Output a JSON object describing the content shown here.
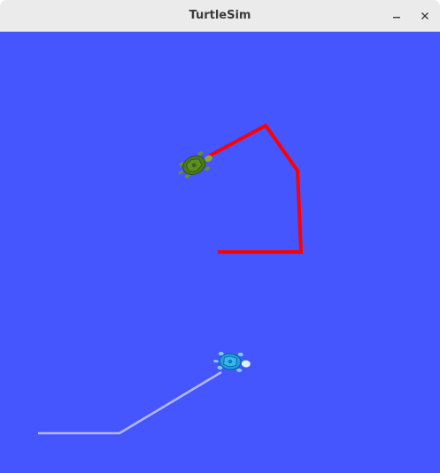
{
  "window": {
    "title": "TurtleSim",
    "minimize_icon": "minimize-icon",
    "close_icon": "close-icon"
  },
  "canvas": {
    "background_color": "#4556ff"
  },
  "turtles": [
    {
      "name_icon": "turtle-icon",
      "shell_color": "#4b7a1c",
      "pen_color": "#ff0000"
    },
    {
      "name_icon": "turtle-icon",
      "shell_color": "#1c9ee0",
      "pen_color": "#b3b8ff"
    }
  ]
}
